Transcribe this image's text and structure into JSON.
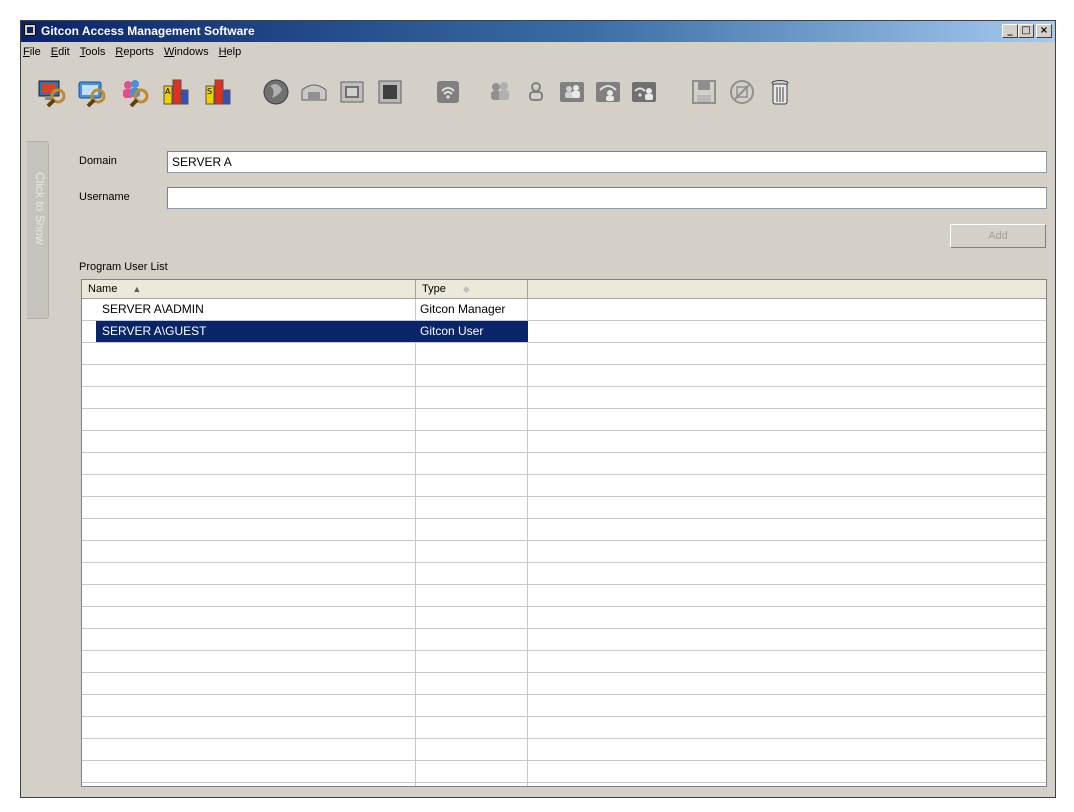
{
  "window": {
    "title": "Gitcon Access Management Software",
    "controls": {
      "minimize": "_",
      "maximize": "□",
      "close": "×"
    }
  },
  "menu": [
    {
      "label": "File",
      "mnemonic": "F"
    },
    {
      "label": "Edit",
      "mnemonic": "E"
    },
    {
      "label": "Tools",
      "mnemonic": "T"
    },
    {
      "label": "Reports",
      "mnemonic": "R"
    },
    {
      "label": "Windows",
      "mnemonic": "W"
    },
    {
      "label": "Help",
      "mnemonic": "H"
    }
  ],
  "toolbar_icons": [
    "search-computer-icon",
    "search-network-icon",
    "search-users-icon",
    "report-chart-icon",
    "report-chart-alt-icon",
    "globe-icon",
    "network-share-icon",
    "window-icon",
    "window-alt-icon",
    "wireless-icon",
    "user-group-icon",
    "user-icon",
    "computer-users-icon",
    "network-users-icon",
    "wireless-users-icon",
    "save-icon",
    "disable-icon",
    "trash-icon"
  ],
  "side_panel": {
    "label": "Click to Show"
  },
  "form": {
    "domain_label": "Domain",
    "domain_value": "SERVER A",
    "username_label": "Username",
    "username_value": "",
    "add_button": "Add"
  },
  "list": {
    "title": "Program User List",
    "columns": [
      {
        "label": "Name",
        "sort": "ascending"
      },
      {
        "label": "Type"
      }
    ],
    "rows": [
      {
        "name": "SERVER A\\ADMIN",
        "type": "Gitcon Manager",
        "selected": false
      },
      {
        "name": "SERVER A\\GUEST",
        "type": "Gitcon User",
        "selected": true
      }
    ]
  },
  "colors": {
    "selection": "#0a246a",
    "title_gradient_start": "#0a246a",
    "title_gradient_end": "#a6caf0",
    "window_bg": "#d4d0c8"
  }
}
